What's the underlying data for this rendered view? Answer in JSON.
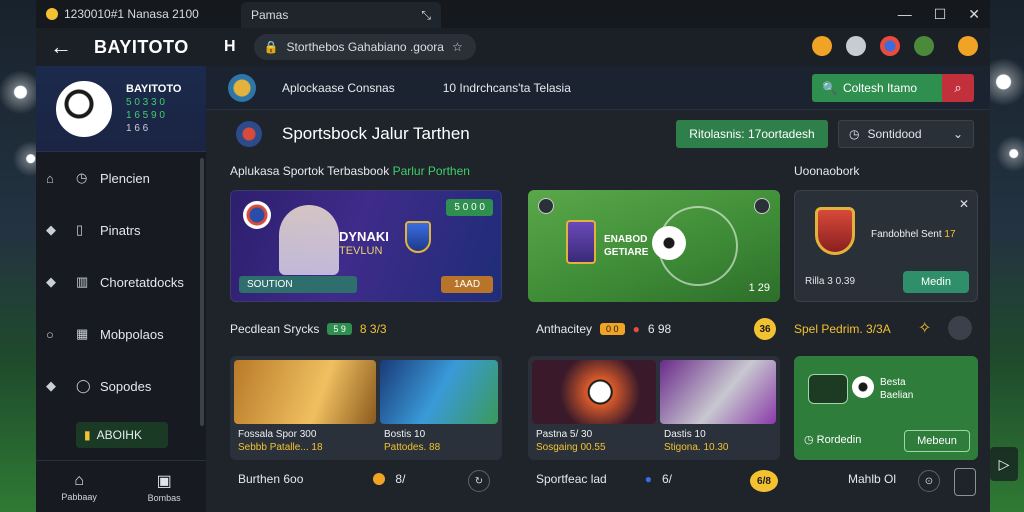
{
  "window": {
    "tab_left_title": "1230010#1 Nanasa 2100",
    "tab_active_title": "Pamas",
    "minimize": "—",
    "maximize": "☐",
    "close": "✕"
  },
  "navbar": {
    "back": "←",
    "brand": "BAYITOTO",
    "home": "H",
    "url": "Storthebos Gahabiano .goora",
    "star": "☆"
  },
  "profile": {
    "name": "BAYITOTO",
    "line1": "5 0 3 3 0",
    "line2": "1 6 5 9 0",
    "line3": "1 6 6"
  },
  "sidebar": {
    "items": [
      {
        "label": "Plencien",
        "icon1": "home-icon",
        "icon2": "clock-icon"
      },
      {
        "label": "Pinatrs",
        "icon1": "diamond-icon",
        "icon2": "square-icon"
      },
      {
        "label": "Choretatdocks",
        "icon1": "diamond-icon",
        "icon2": "chart-icon"
      },
      {
        "label": "Mobpolaos",
        "icon1": "circle-icon",
        "icon2": "grid-icon"
      },
      {
        "label": "Sopodes",
        "icon1": "diamond-icon",
        "icon2": "circle-icon"
      }
    ],
    "cta_label": "ABOIHK",
    "bottom": [
      {
        "label": "Pabbaay",
        "icon": "home-icon"
      },
      {
        "label": "Bombas",
        "icon": "image-icon"
      }
    ]
  },
  "header": {
    "tabs": [
      "Aplockaase Consnas",
      "10 Indrchcans'ta Telasia"
    ],
    "search_label": "Coltesh Itamo"
  },
  "title_row": {
    "title": "Sportsbock Jalur Tarthen",
    "primary_button": "Ritolasnis: 17oortadesh",
    "select_label": "Sontidood"
  },
  "sections": {
    "left_label": "Aplukasa Sportok Terbasbook",
    "left_label_green": "Parlur Porthen",
    "right_label": "Uoonaobork"
  },
  "hero": {
    "tag": "5 0 0 0",
    "title": "DYNAKI",
    "subtitle": "TEVLUN",
    "bottom_left": "SOUTION",
    "bottom_right": "1AAD"
  },
  "field": {
    "caption1": "ENABOD",
    "caption2": "GETIARE",
    "value": "1 29"
  },
  "promo": {
    "title": "Fandobhel Sent",
    "value": "17",
    "caption": "Rilla 3 0.39",
    "button": "Medin"
  },
  "row_labels": {
    "a": "Pecdlean Srycks",
    "a_pill": "5 9",
    "a_value": "8 3/3",
    "b": "Anthacitey",
    "b_pill": "0 0",
    "b_value": "6 98",
    "b_coin": "36",
    "c": "Spel Pedrim. 3/3A"
  },
  "products": {
    "p1_cap1": "Fossala Spor 300",
    "p1_cap2": "Sebbb Patalle... 18",
    "p2_cap1": "Bostis 10",
    "p2_cap2": "Pattodes. 88",
    "p3_cap1": "Pastna 5/ 30",
    "p3_cap2": "Sosgaing 00.55",
    "p4_cap1": "Dastis 10",
    "p4_cap2": "Stigona. 10.30",
    "green_cap1": "Besta",
    "green_cap2": "Baelian",
    "green_footer": "Rordedin",
    "green_button": "Mebeun"
  },
  "bottom": {
    "a": "Burthen 6oo",
    "a_val": "8/",
    "b": "Sportfeac lad",
    "b_val": "6/",
    "b_coin": "6/8",
    "c": "Mahlb Ol"
  },
  "colors": {
    "accent_green": "#2f8f4e",
    "accent_red": "#c2303b",
    "coin_yellow": "#f2c230"
  }
}
